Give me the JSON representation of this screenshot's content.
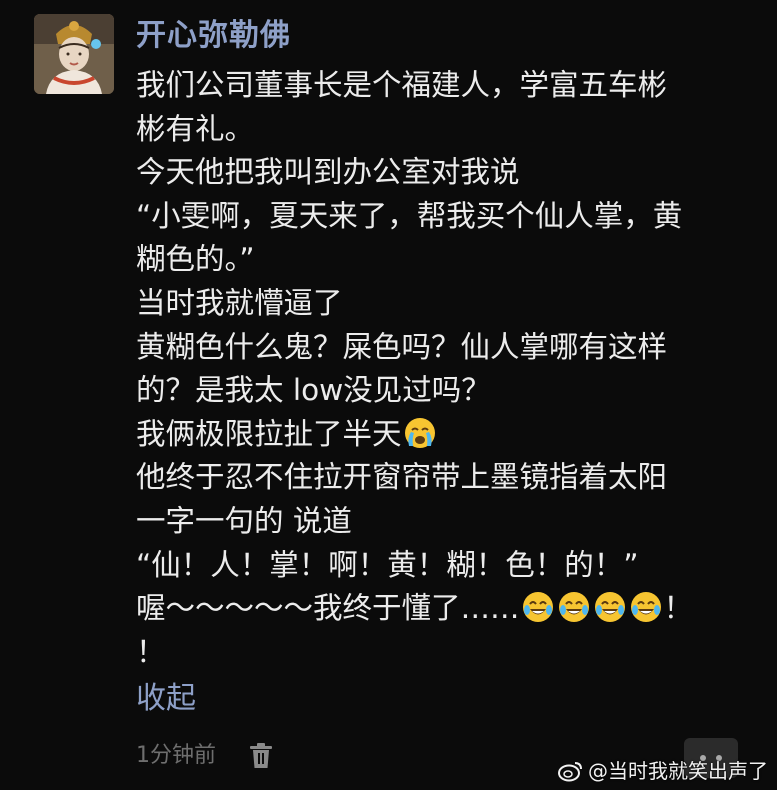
{
  "post": {
    "username": "开心弥勒佛",
    "lines": [
      "我们公司董事长是个福建人，学富五车彬",
      "彬有礼。",
      "今天他把我叫到办公室对我说",
      "“小雯啊，夏天来了，帮我买个仙人掌，黄",
      "糊色的。”",
      "当时我就懵逼了",
      "黄糊色什么鬼？屎色吗？仙人掌哪有这样",
      "的？是我太 low没见过吗？",
      "我俩极限拉扯了半天",
      "他终于忍不住拉开窗帘带上墨镜指着太阳",
      "一字一句的 说道",
      "“仙！人！掌！啊！黄！糊！色！的！”",
      "喔～～～～～我终于懂了……",
      "！"
    ],
    "line13_suffix": "！",
    "collapse_label": "收起",
    "timestamp": "1分钟前"
  },
  "icons": {
    "avatar": "bodhisattva-statue-avatar",
    "crying_laughing_emoji": "face-with-tears-of-joy-emoji",
    "sobbing_emoji": "loudly-crying-emoji",
    "delete": "trash-icon",
    "more": "more-dots-icon",
    "watermark_logo": "weibo-logo-icon"
  },
  "colors": {
    "background": "#0b0b0b",
    "text": "#ececec",
    "link": "#8ea0c8",
    "muted": "#6e6e6e"
  },
  "watermark": {
    "text": "@当时我就笑出声了"
  }
}
